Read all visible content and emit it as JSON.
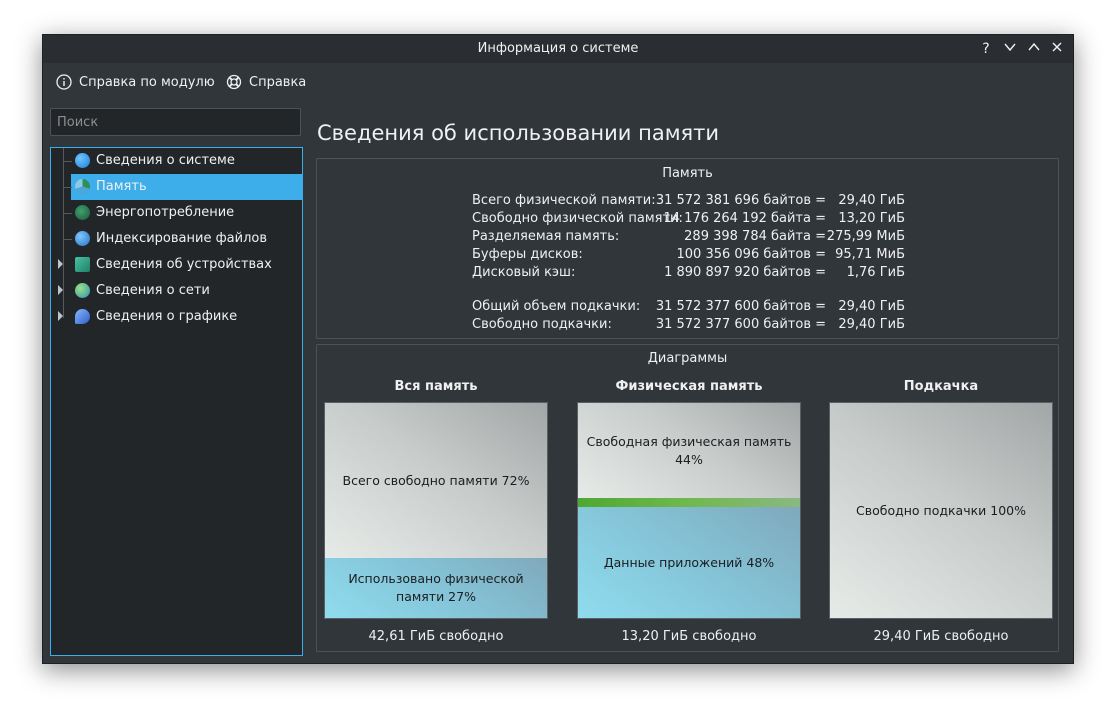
{
  "window": {
    "title": "Информация о системе",
    "controls": {
      "help": "?",
      "minimize": "﹀",
      "maximize": "︿",
      "close": "✕"
    }
  },
  "toolbar": {
    "module_help_label": "Справка по модулю",
    "help_label": "Справка"
  },
  "search": {
    "placeholder": "Поиск",
    "value": ""
  },
  "sidebar": {
    "items": [
      {
        "label": "Сведения о системе",
        "icon": "info-icon",
        "expandable": false,
        "selected": false
      },
      {
        "label": "Память",
        "icon": "memory-icon",
        "expandable": false,
        "selected": true
      },
      {
        "label": "Энергопотребление",
        "icon": "energy-icon",
        "expandable": false,
        "selected": false
      },
      {
        "label": "Индексирование файлов",
        "icon": "file-index-icon",
        "expandable": false,
        "selected": false
      },
      {
        "label": "Сведения об устройствах",
        "icon": "devices-icon",
        "expandable": true,
        "selected": false
      },
      {
        "label": "Сведения о сети",
        "icon": "network-icon",
        "expandable": true,
        "selected": false
      },
      {
        "label": "Сведения о графике",
        "icon": "graphics-icon",
        "expandable": true,
        "selected": false
      }
    ]
  },
  "main": {
    "title": "Сведения об использовании памяти",
    "memory": {
      "title": "Память",
      "rows": [
        {
          "label": "Всего физической памяти:",
          "bytes": "31 572 381 696 байтов =",
          "human": "29,40 ГиБ"
        },
        {
          "label": "Свободно физической памяти:",
          "bytes": "14 176 264 192 байта =",
          "human": "13,20 ГиБ"
        },
        {
          "label": "Разделяемая память:",
          "bytes": "289 398 784 байта =",
          "human": "275,99 МиБ"
        },
        {
          "label": "Буферы дисков:",
          "bytes": "100 356 096 байтов =",
          "human": "95,71 МиБ"
        },
        {
          "label": "Дисковый кэш:",
          "bytes": "1 890 897 920 байтов =",
          "human": "1,76 ГиБ"
        },
        {
          "label": "Общий объем подкачки:",
          "bytes": "31 572 377 600 байтов =",
          "human": "29,40 ГиБ"
        },
        {
          "label": "Свободно подкачки:",
          "bytes": "31 572 377 600 байтов =",
          "human": "29,40 ГиБ"
        }
      ]
    },
    "charts": {
      "title": "Диаграммы",
      "items": [
        {
          "heading": "Вся память",
          "footer": "42,61 ГиБ свободно",
          "segments": [
            {
              "label": "Всего свободно памяти 72%",
              "percent": 72,
              "kind": "free"
            },
            {
              "label": "Использовано физической памяти 27%",
              "percent": 27,
              "kind": "used"
            }
          ]
        },
        {
          "heading": "Физическая память",
          "footer": "13,20 ГиБ свободно",
          "segments": [
            {
              "label": "Свободная физическая память 44%",
              "percent": 44,
              "kind": "free"
            },
            {
              "label": "",
              "percent": 4,
              "kind": "green"
            },
            {
              "label": "Данные приложений 48%",
              "percent": 48,
              "kind": "used"
            }
          ]
        },
        {
          "heading": "Подкачка",
          "footer": "29,40 ГиБ свободно",
          "segments": [
            {
              "label": "Свободно подкачки 100%",
              "percent": 100,
              "kind": "free"
            }
          ]
        }
      ]
    }
  },
  "colors": {
    "accent": "#3daee9",
    "window_bg": "#31363b",
    "view_bg": "#232629",
    "text": "#eff0f1"
  }
}
